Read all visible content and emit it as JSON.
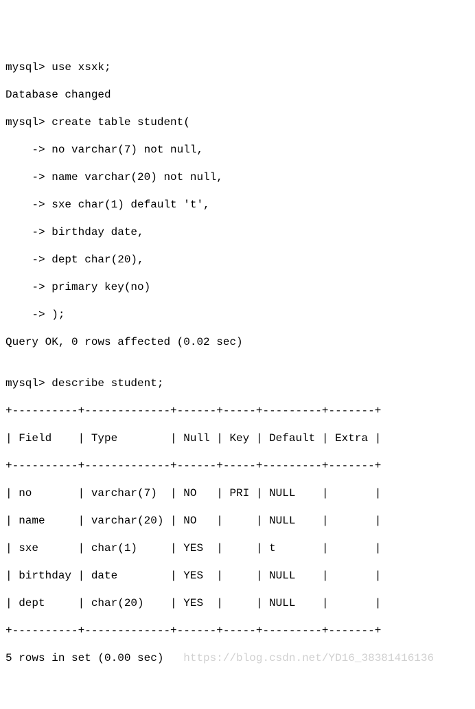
{
  "session": {
    "lines": [
      "mysql> use xsxk;",
      "Database changed",
      "mysql> create table student(",
      "    -> no varchar(7) not null,",
      "    -> name varchar(20) not null,",
      "    -> sxe char(1) default 't',",
      "    -> birthday date,",
      "    -> dept char(20),",
      "    -> primary key(no)",
      "    -> );",
      "Query OK, 0 rows affected (0.02 sec)",
      "",
      "mysql> describe student;"
    ]
  },
  "table": {
    "border_top": "+----------+-------------+------+-----+---------+-------+",
    "header": "| Field    | Type        | Null | Key | Default | Extra |",
    "border_mid": "+----------+-------------+------+-----+---------+-------+",
    "rows": [
      "| no       | varchar(7)  | NO   | PRI | NULL    |       |",
      "| name     | varchar(20) | NO   |     | NULL    |       |",
      "| sxe      | char(1)     | YES  |     | t       |       |",
      "| birthday | date        | YES  |     | NULL    |       |",
      "| dept     | char(20)    | YES  |     | NULL    |       |"
    ],
    "border_bot": "+----------+-------------+------+-----+---------+-------+",
    "columns": [
      "Field",
      "Type",
      "Null",
      "Key",
      "Default",
      "Extra"
    ],
    "data": [
      {
        "Field": "no",
        "Type": "varchar(7)",
        "Null": "NO",
        "Key": "PRI",
        "Default": "NULL",
        "Extra": ""
      },
      {
        "Field": "name",
        "Type": "varchar(20)",
        "Null": "NO",
        "Key": "",
        "Default": "NULL",
        "Extra": ""
      },
      {
        "Field": "sxe",
        "Type": "char(1)",
        "Null": "YES",
        "Key": "",
        "Default": "t",
        "Extra": ""
      },
      {
        "Field": "birthday",
        "Type": "date",
        "Null": "YES",
        "Key": "",
        "Default": "NULL",
        "Extra": ""
      },
      {
        "Field": "dept",
        "Type": "char(20)",
        "Null": "YES",
        "Key": "",
        "Default": "NULL",
        "Extra": ""
      }
    ]
  },
  "footer": {
    "result": "5 rows in set (0.00 sec)",
    "watermark": "   https://blog.csdn.net/YD16_38381416136"
  }
}
